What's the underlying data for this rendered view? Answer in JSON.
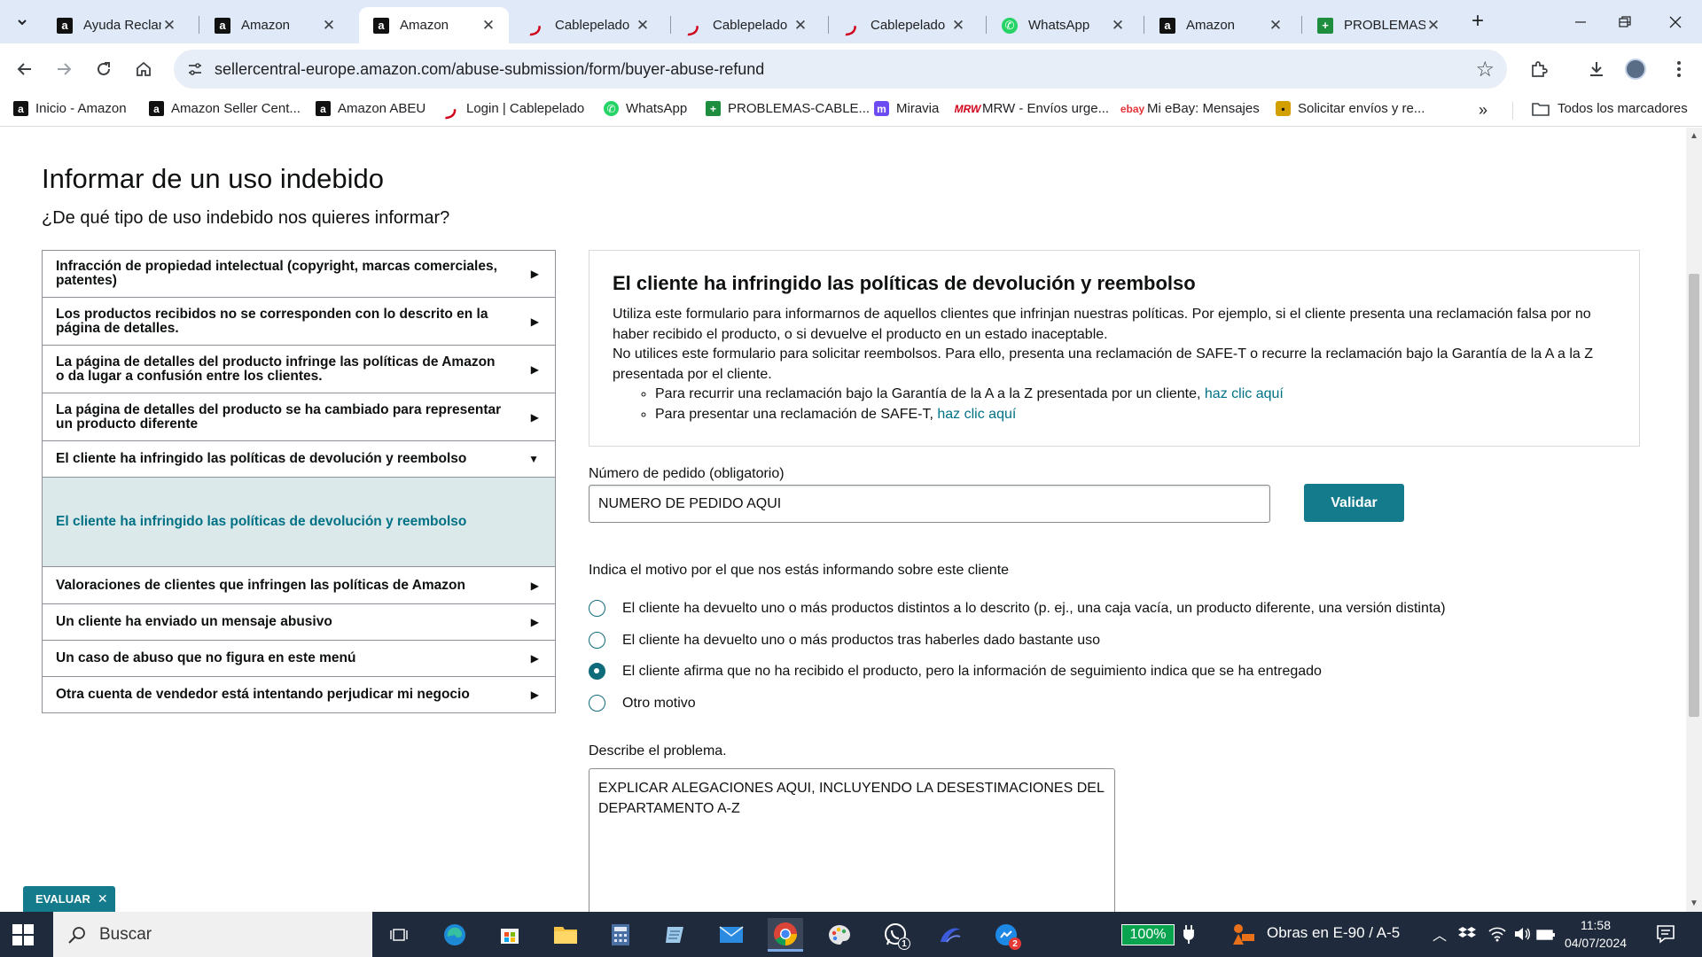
{
  "browser": {
    "tabs": [
      {
        "title": "Ayuda Reclam",
        "favicon": "amazon-icon"
      },
      {
        "title": "Amazon",
        "favicon": "amazon-icon"
      },
      {
        "title": "Amazon",
        "favicon": "amazon-icon",
        "active": true
      },
      {
        "title": "Cablepelado",
        "favicon": "cablepelado-icon"
      },
      {
        "title": "Cablepelado",
        "favicon": "cablepelado-icon"
      },
      {
        "title": "Cablepelado",
        "favicon": "cablepelado-icon"
      },
      {
        "title": "WhatsApp",
        "favicon": "whatsapp-icon"
      },
      {
        "title": "Amazon",
        "favicon": "amazon-icon"
      },
      {
        "title": "PROBLEMAS",
        "favicon": "sheets-icon"
      }
    ],
    "url": "sellercentral-europe.amazon.com/abuse-submission/form/buyer-abuse-refund",
    "bookmarks": [
      {
        "label": "Inicio - Amazon",
        "favicon": "amazon-icon"
      },
      {
        "label": "Amazon Seller Cent...",
        "favicon": "amazon-icon"
      },
      {
        "label": "Amazon ABEU",
        "favicon": "amazon-icon"
      },
      {
        "label": "Login | Cablepelado",
        "favicon": "cablepelado-icon"
      },
      {
        "label": "WhatsApp",
        "favicon": "whatsapp-icon"
      },
      {
        "label": "PROBLEMAS-CABLE...",
        "favicon": "sheets-icon"
      },
      {
        "label": "Miravia",
        "favicon": "miravia-icon"
      },
      {
        "label": "MRW - Envíos urge...",
        "favicon": "mrw-icon"
      },
      {
        "label": "Mi eBay: Mensajes",
        "favicon": "ebay-icon"
      },
      {
        "label": "Solicitar envíos y re...",
        "favicon": "solicitar-icon"
      }
    ],
    "all_bookmarks_label": "Todos los marcadores"
  },
  "page": {
    "title": "Informar de un uso indebido",
    "subtitle": "¿De qué tipo de uso indebido nos quieres informar?",
    "menu": [
      {
        "label": "Infracción de propiedad intelectual (copyright, marcas comerciales, patentes)",
        "state": "collapsed"
      },
      {
        "label": "Los productos recibidos no se corresponden con lo descrito en la página de detalles.",
        "state": "collapsed"
      },
      {
        "label": "La página de detalles del producto infringe las políticas de Amazon o da lugar a confusión entre los clientes.",
        "state": "collapsed"
      },
      {
        "label": "La página de detalles del producto se ha cambiado para representar un producto diferente",
        "state": "collapsed"
      },
      {
        "label": "El cliente ha infringido las políticas de devolución y reembolso",
        "state": "expanded"
      },
      {
        "label": "Valoraciones de clientes que infringen las políticas de Amazon",
        "state": "collapsed"
      },
      {
        "label": "Un cliente ha enviado un mensaje abusivo",
        "state": "collapsed"
      },
      {
        "label": "Un caso de abuso que no figura en este menú",
        "state": "collapsed"
      },
      {
        "label": "Otra cuenta de vendedor está intentando perjudicar mi negocio",
        "state": "collapsed"
      }
    ],
    "menu_sub_selected": "El cliente ha infringido las políticas de devolución y reembolso",
    "info": {
      "heading": "El cliente ha infringido las políticas de devolución y reembolso",
      "para1": "Utiliza este formulario para informarnos de aquellos clientes que infrinjan nuestras políticas. Por ejemplo, si el cliente presenta una reclamación falsa por no haber recibido el producto, o si devuelve el producto en un estado inaceptable.",
      "para2": "No utilices este formulario para solicitar reembolsos. Para ello, presenta una reclamación de SAFE-T o recurre la reclamación bajo la Garantía de la A a la Z presentada por el cliente.",
      "bullet1_text": "Para recurrir una reclamación bajo la Garantía de la A a la Z presentada por un cliente, ",
      "bullet1_link": "haz clic aquí",
      "bullet2_text": "Para presentar una reclamación de SAFE-T, ",
      "bullet2_link": "haz clic aquí"
    },
    "order": {
      "label": "Número de pedido (obligatorio)",
      "value": "NUMERO DE PEDIDO AQUI",
      "validate_label": "Validar"
    },
    "reason": {
      "label": "Indica el motivo por el que nos estás informando sobre este cliente",
      "options": [
        {
          "label": "El cliente ha devuelto uno o más productos distintos a lo descrito (p. ej., una caja vacía, un producto diferente, una versión distinta)",
          "selected": false
        },
        {
          "label": "El cliente ha devuelto uno o más productos tras haberles dado bastante uso",
          "selected": false
        },
        {
          "label": "El cliente afirma que no ha recibido el producto, pero la información de seguimiento indica que se ha entregado",
          "selected": true
        },
        {
          "label": "Otro motivo",
          "selected": false
        }
      ]
    },
    "problem": {
      "label": "Describe el problema.",
      "value": "EXPLICAR ALEGACIONES AQUI, INCLUYENDO LA DESESTIMACIONES DEL DEPARTAMENTO A-Z"
    },
    "evaluar_label": "EVALUAR"
  },
  "taskbar": {
    "search_placeholder": "Buscar",
    "battery": "100%",
    "news": "Obras en E-90 / A-5",
    "time": "11:58",
    "date": "04/07/2024",
    "whatsapp_badge": "1",
    "app_badge": "2"
  },
  "colors": {
    "tabstrip": "#dfe9f7",
    "link": "#007185",
    "button": "#137b8c",
    "taskbar": "#1f2a3c"
  }
}
